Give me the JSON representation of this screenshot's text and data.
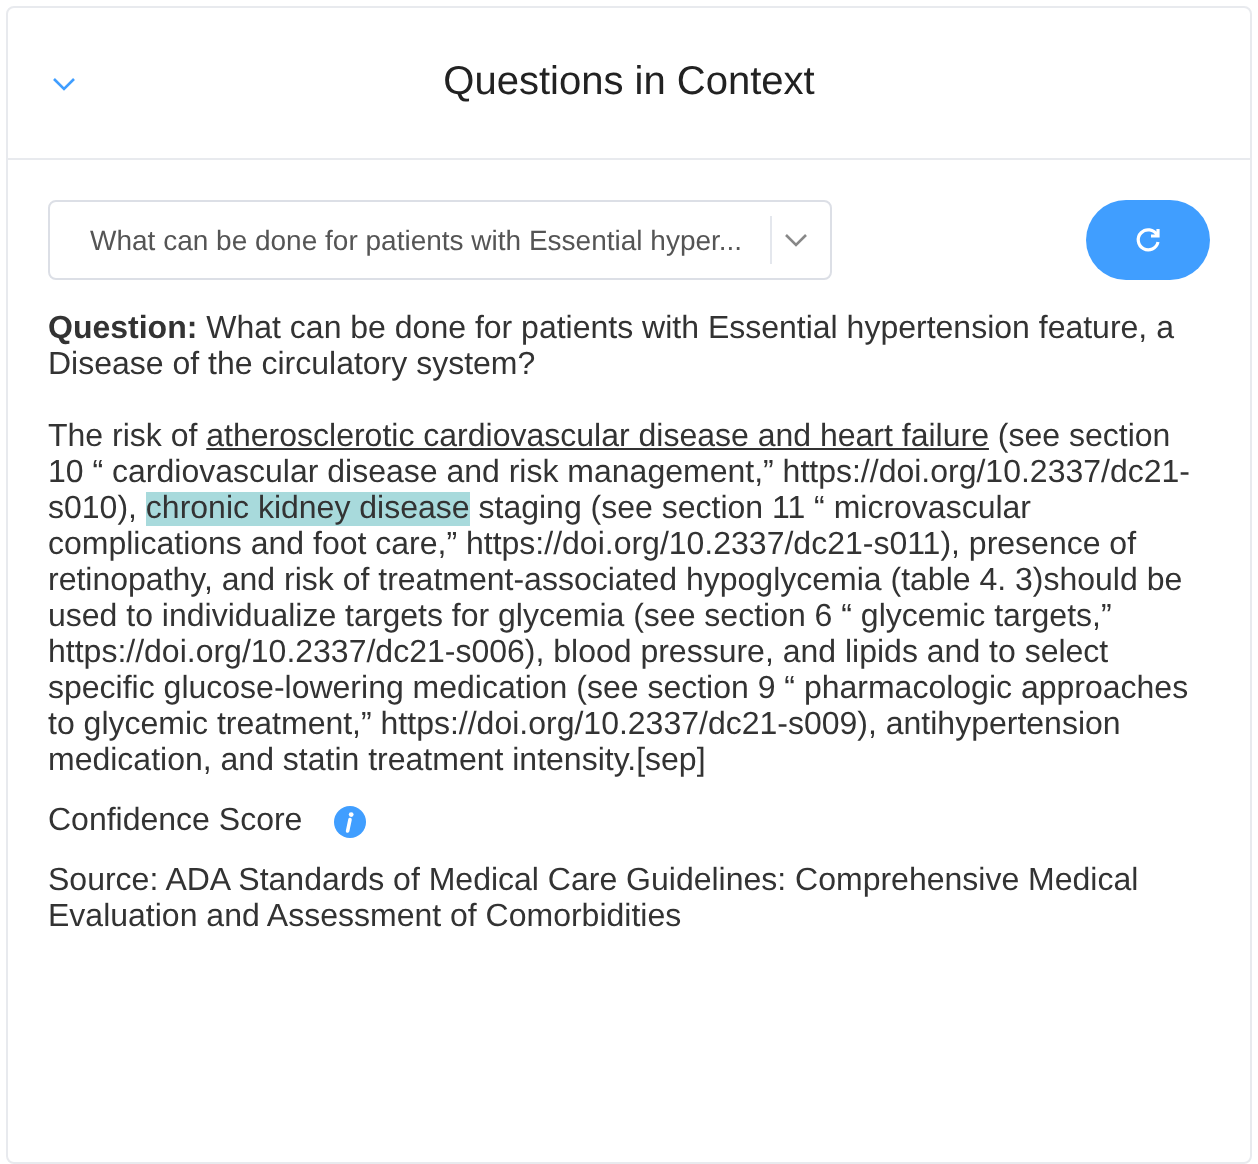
{
  "header": {
    "title": "Questions in Context",
    "expanded": true
  },
  "question_select": {
    "value": "What can be done for patients with Essential hyper..."
  },
  "question": {
    "label": "Question:",
    "text": "What can be done for patients with Essential hypertension feature, a Disease of the circulatory system?"
  },
  "answer": [
    {
      "kind": "plain",
      "text": "The risk of "
    },
    {
      "kind": "underline",
      "text": "atherosclerotic cardiovascular disease and heart failure"
    },
    {
      "kind": "plain",
      "text": " (see section 10 “ cardiovascular disease and risk management,” https://doi.org/10.2337/dc21-s010), "
    },
    {
      "kind": "highlight",
      "text": "chronic kidney disease"
    },
    {
      "kind": "plain",
      "text": " staging (see section 11 “ microvascular complications and foot care,” https://doi.org/10.2337/dc21-s011), presence of retinopathy, and risk of treatment-associated hypoglycemia (table 4. 3)should be used to individualize targets for glycemia (see section 6 “ glycemic targets,” https://doi.org/10.2337/dc21-s006), blood pressure, and lipids and to select specific glucose-lowering medication (see section 9 “ pharmacologic approaches to glycemic treatment,” https://doi.org/10.2337/dc21-s009), antihypertension medication, and statin treatment intensity.[sep]"
    }
  ],
  "confidence": {
    "label": "Confidence Score"
  },
  "source": "Source: ADA Standards of Medical Care Guidelines: Comprehensive Medical Evaluation and Assessment of Comorbidities"
}
